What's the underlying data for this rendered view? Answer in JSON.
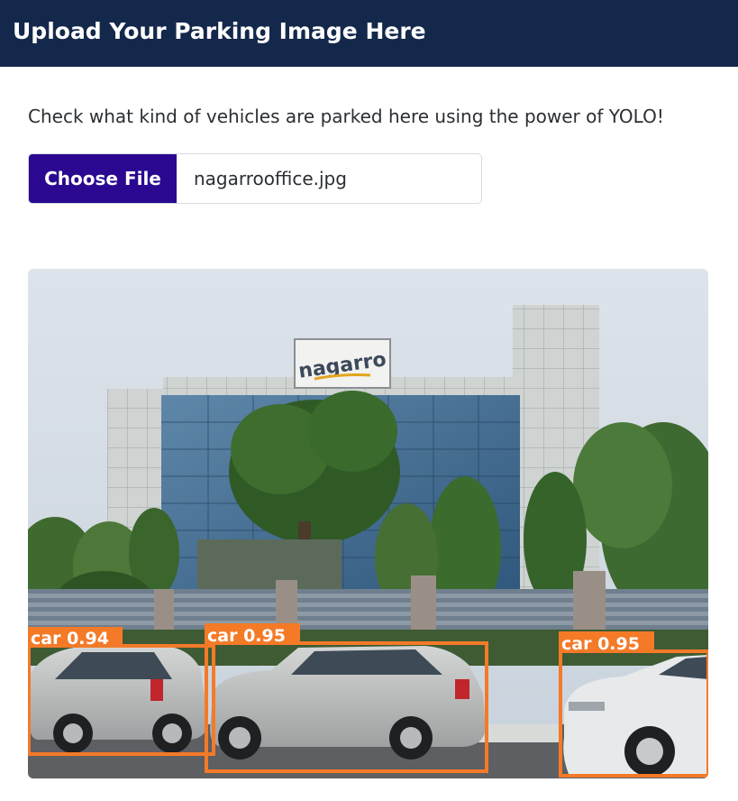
{
  "header": {
    "title": "Upload Your Parking Image Here"
  },
  "intro": "Check what kind of vehicles are parked here using the power of YOLO!",
  "file_input": {
    "button_label": "Choose File",
    "file_name": "nagarrooffice.jpg"
  },
  "result_image": {
    "sign_text": "nagarro",
    "detections": [
      {
        "label": "car 0.94"
      },
      {
        "label": "car 0.95"
      },
      {
        "label": "car 0.95"
      }
    ],
    "box_color": "#f47a28"
  }
}
